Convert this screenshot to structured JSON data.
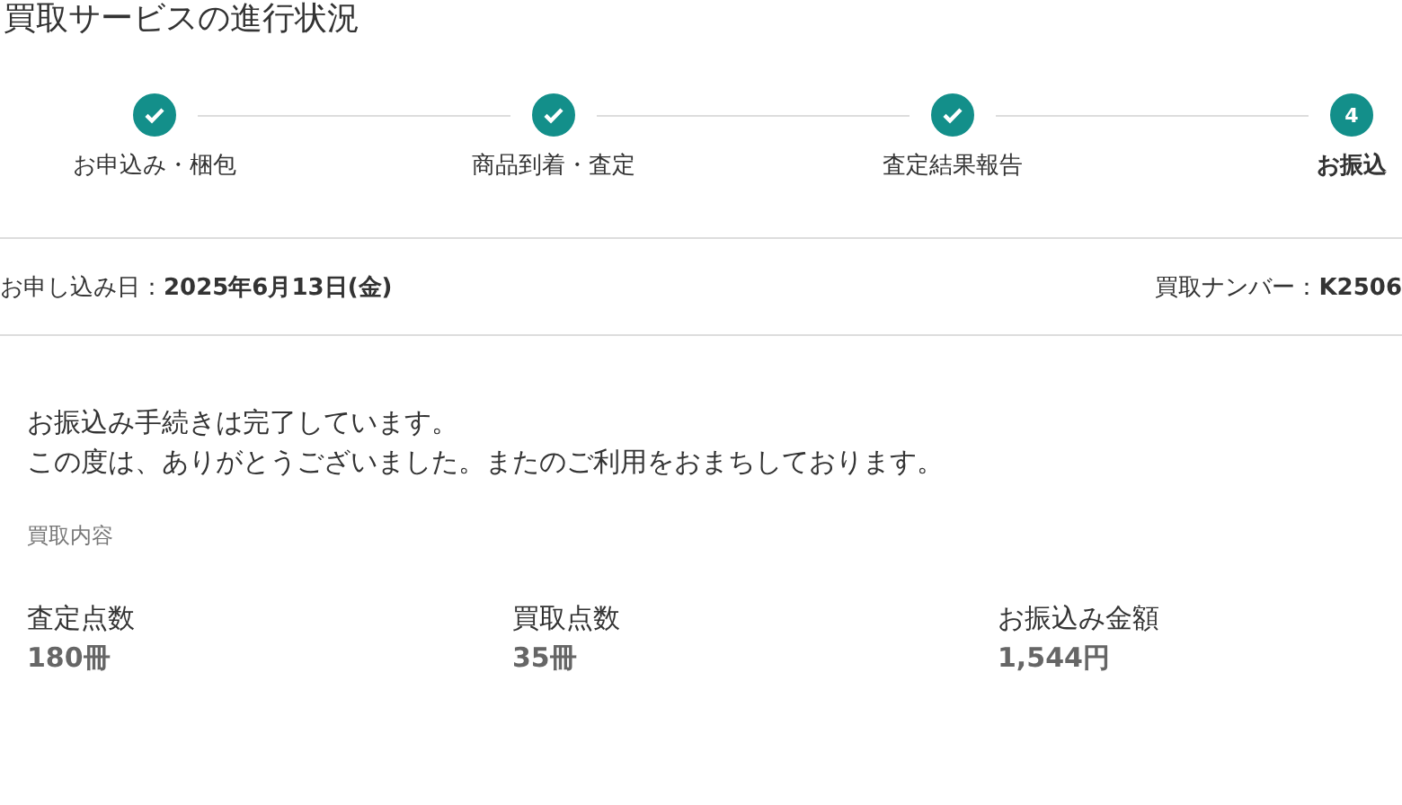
{
  "title": "買取サービスの進行状況",
  "steps": [
    {
      "label": "お申込み・梱包",
      "done": true
    },
    {
      "label": "商品到着・査定",
      "done": true
    },
    {
      "label": "査定結果報告",
      "done": true
    },
    {
      "label": "お振込",
      "done": false,
      "number": "4"
    }
  ],
  "info": {
    "date": "お申し込み日：**2025年6月13日(金)**",
    "number": "買取ナンバー：**K2506**"
  },
  "message": [
    "お振込み手続きは完了しています。",
    "この度は、ありがとうございました。またのご利用をおまちしております。"
  ],
  "section_label": "買取内容",
  "stats": [
    {
      "label": "査定点数",
      "value": "180冊"
    },
    {
      "label": "買取点数",
      "value": "35冊"
    },
    {
      "label": "お振込み金額",
      "value": "1,544円"
    }
  ]
}
